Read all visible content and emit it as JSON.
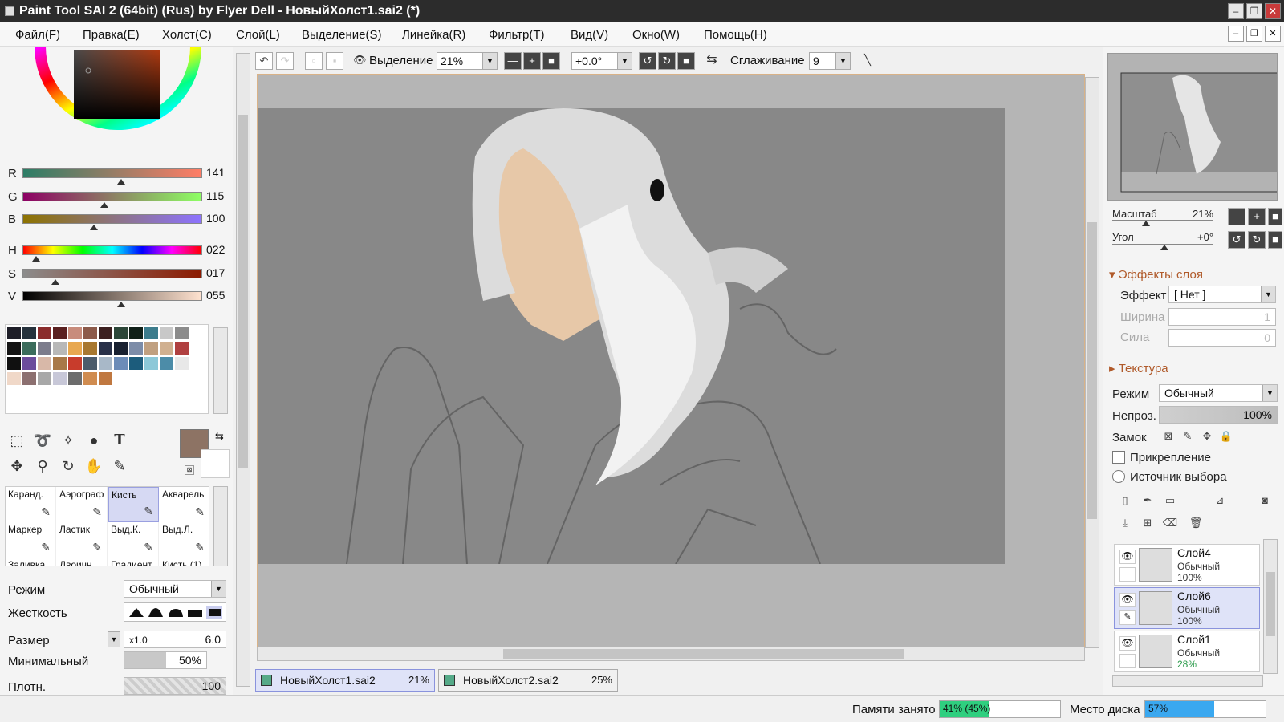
{
  "window": {
    "title": "Paint Tool SAI 2 (64bit) (Rus) by Flyer Dell - НовыйХолст1.sai2 (*)"
  },
  "menu": [
    "Файл(F)",
    "Правка(E)",
    "Холст(C)",
    "Слой(L)",
    "Выделение(S)",
    "Линейка(R)",
    "Фильтр(T)",
    "Вид(V)",
    "Окно(W)",
    "Помощь(H)"
  ],
  "color_sliders": [
    {
      "label": "R",
      "value": "141",
      "fraction": 0.55
    },
    {
      "label": "G",
      "value": "115",
      "fraction": 0.45
    },
    {
      "label": "B",
      "value": "100",
      "fraction": 0.39
    },
    {
      "label": "H",
      "value": "022",
      "fraction": 0.06
    },
    {
      "label": "S",
      "value": "017",
      "fraction": 0.17
    },
    {
      "label": "V",
      "value": "055",
      "fraction": 0.55
    }
  ],
  "current_color": "#8d7364",
  "brushes": [
    {
      "label": "Каранд.",
      "icon": "pencil-icon"
    },
    {
      "label": "Аэрограф",
      "icon": "airbrush-icon"
    },
    {
      "label": "Кисть",
      "icon": "brush-icon",
      "active": true
    },
    {
      "label": "Акварель",
      "icon": "watercolor-icon"
    },
    {
      "label": "Маркер",
      "icon": "marker-icon"
    },
    {
      "label": "Ластик",
      "icon": "eraser-icon"
    },
    {
      "label": "Выд.К.",
      "icon": "select-pen-icon"
    },
    {
      "label": "Выд.Л.",
      "icon": "select-eraser-icon"
    },
    {
      "label": "Заливка",
      "icon": "fill-icon"
    },
    {
      "label": "Двоичн.",
      "icon": "binary-icon"
    },
    {
      "label": "Градиент",
      "icon": "gradient-icon"
    },
    {
      "label": "Кисть (1)",
      "icon": "brush2-icon"
    }
  ],
  "brush_props": {
    "mode_label": "Режим",
    "mode_value": "Обычный",
    "hardness_label": "Жесткость",
    "size_label": "Размер",
    "size_mult": "x1.0",
    "size_value": "6.0",
    "min_label": "Минимальный",
    "min_value": "50%",
    "density_label": "Плотн.",
    "density_value": "100"
  },
  "toolbar": {
    "selection_label": "Выделение",
    "zoom_value": "21%",
    "angle_value": "+0.0°",
    "smoothing_label": "Сглаживание",
    "smoothing_value": "9"
  },
  "tabs": [
    {
      "name": "НовыйХолст1.sai2",
      "pct": "21%",
      "active": true
    },
    {
      "name": "НовыйХолст2.sai2",
      "pct": "25%",
      "active": false
    }
  ],
  "navigator": {
    "zoom_label": "Масштаб",
    "zoom_value": "21%",
    "angle_label": "Угол",
    "angle_value": "+0°"
  },
  "layer_effects": {
    "title": "Эффекты слоя",
    "effect_label": "Эффект",
    "effect_value": "[ Нет ]",
    "width_label": "Ширина",
    "width_value": "1",
    "strength_label": "Сила",
    "strength_value": "0"
  },
  "texture": {
    "title": "Текстура"
  },
  "layer_props": {
    "mode_label": "Режим",
    "mode_value": "Обычный",
    "opacity_label": "Непроз.",
    "opacity_value": "100%",
    "lock_label": "Замок",
    "clip_label": "Прикрепление",
    "source_label": "Источник выбора"
  },
  "layers": [
    {
      "name": "Слой4",
      "mode": "Обычный",
      "opacity": "100%",
      "active": false
    },
    {
      "name": "Слой6",
      "mode": "Обычный",
      "opacity": "100%",
      "active": true
    },
    {
      "name": "Слой1",
      "mode": "Обычный",
      "opacity": "28%",
      "active": false
    }
  ],
  "status": {
    "memory_label": "Памяти занято",
    "memory_value": "41% (45%)",
    "memory_fraction": 0.41,
    "disk_label": "Место диска",
    "disk_value": "57%",
    "disk_fraction": 0.57
  }
}
